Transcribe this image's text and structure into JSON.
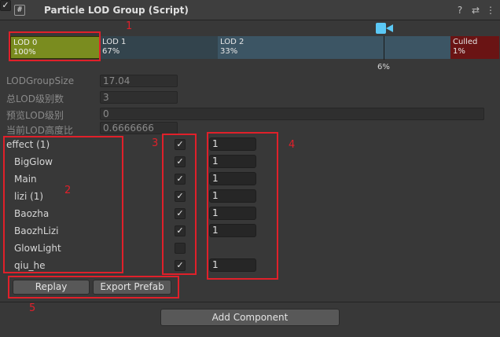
{
  "header": {
    "title": "Particle LOD Group (Script)",
    "script_icon": "#",
    "enabled_check": "✓",
    "help_icon": "?",
    "settings_icon": "⇄",
    "menu_icon": "⋮"
  },
  "lod_bar": {
    "segments": [
      {
        "name": "LOD 0",
        "percent": "100%",
        "color": "#7a8c1f"
      },
      {
        "name": "LOD 1",
        "percent": "67%",
        "color": "#33444d"
      },
      {
        "name": "LOD 2",
        "percent": "33%",
        "color": "#3c5564"
      },
      {
        "name": "Culled",
        "percent": "1%",
        "color": "#6a1414"
      }
    ],
    "marker_label": "6%",
    "camera_icon": "camera-icon"
  },
  "properties": [
    {
      "label": "LODGroupSize",
      "value": "17.04"
    },
    {
      "label": "总LOD级别数",
      "value": "3"
    },
    {
      "label": "预览LOD级别",
      "value": "0"
    },
    {
      "label": "当前LOD高度比",
      "value": "0.6666666"
    }
  ],
  "rows": [
    {
      "name": "effect (1)",
      "checked": "✓",
      "lod": "1"
    },
    {
      "name": "BigGlow",
      "checked": "✓",
      "lod": "1"
    },
    {
      "name": "Main",
      "checked": "✓",
      "lod": "1"
    },
    {
      "name": "lizi (1)",
      "checked": "✓",
      "lod": "1"
    },
    {
      "name": "Baozha",
      "checked": "✓",
      "lod": "1"
    },
    {
      "name": "BaozhLizi",
      "checked": "✓",
      "lod": "1"
    },
    {
      "name": "GlowLight",
      "checked": "",
      "lod": ""
    },
    {
      "name": "qiu_he",
      "checked": "✓",
      "lod": "1"
    }
  ],
  "buttons": {
    "replay": "Replay",
    "export_prefab": "Export Prefab",
    "add_component": "Add Component"
  },
  "annotations": [
    "1",
    "2",
    "3",
    "4",
    "5"
  ],
  "colors": {
    "annotation": "#e0202a",
    "background": "#383838",
    "camera": "#5bc8f5"
  }
}
